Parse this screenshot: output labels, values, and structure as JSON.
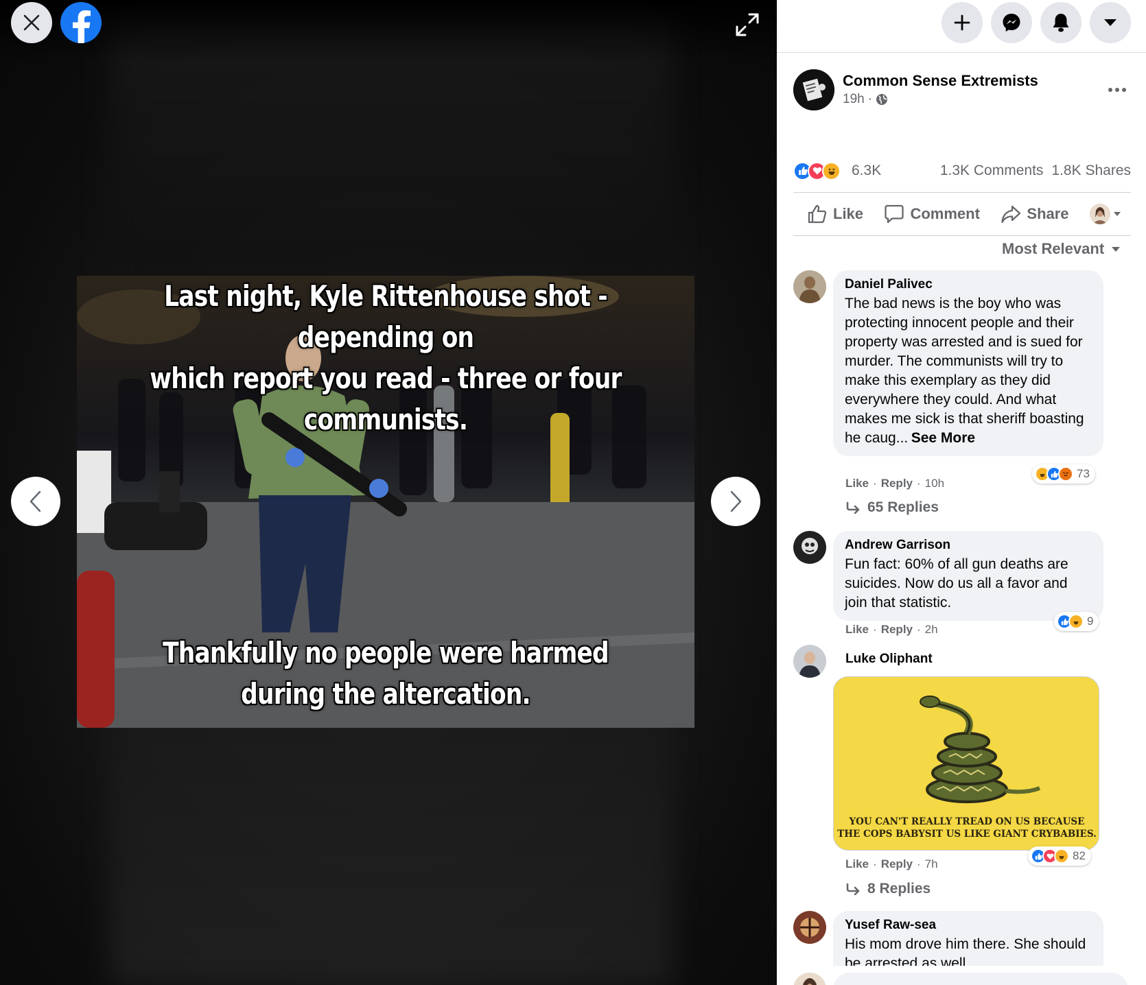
{
  "viewer": {
    "meme_top_line1": "Last night, Kyle Rittenhouse shot -depending on",
    "meme_top_line2": "which report you read - three or four communists.",
    "meme_bottom_line1": "Thankfully no people were harmed",
    "meme_bottom_line2": "during the altercation."
  },
  "post": {
    "page_name": "Common Sense Extremists",
    "time": "19h",
    "reaction_count": "6.3K",
    "comments_count": "1.3K Comments",
    "shares_count": "1.8K Shares",
    "reactions": [
      "like",
      "love",
      "haha"
    ]
  },
  "actions": {
    "like": "Like",
    "comment": "Comment",
    "share": "Share"
  },
  "sort_label": "Most Relevant",
  "comments": [
    {
      "author": "Daniel Palivec",
      "text": "The bad news is the boy who was protecting innocent people and their property was arrested and is sued for murder. The communists will try to make this exemplary as they did everywhere they could. And what makes me sick is that sheriff boasting he caug...",
      "see_more": "See More",
      "reaction_count": "73",
      "reactions": [
        "haha",
        "like",
        "angry"
      ],
      "like": "Like",
      "reply": "Reply",
      "time": "10h",
      "replies": "65 Replies"
    },
    {
      "author": "Andrew Garrison",
      "text": "Fun fact: 60% of all gun deaths are suicides. Now do us all a favor and join that statistic.",
      "reaction_count": "9",
      "reactions": [
        "like",
        "haha"
      ],
      "like": "Like",
      "reply": "Reply",
      "time": "2h"
    },
    {
      "author": "Luke Oliphant",
      "image_caption_line1": "YOU CAN'T REALLY TREAD ON US BECAUSE",
      "image_caption_line2": "THE COPS BABYSIT US LIKE GIANT CRYBABIES.",
      "reaction_count": "82",
      "reactions": [
        "like",
        "love",
        "haha"
      ],
      "like": "Like",
      "reply": "Reply",
      "time": "7h",
      "replies": "8 Replies"
    },
    {
      "author": "Yusef Raw-sea",
      "text": "His mom drove him there. She should be arrested as well"
    }
  ],
  "colors": {
    "facebook_blue": "#1877f2",
    "like": "#1877f2",
    "love": "#f33e58",
    "haha": "#f7b125",
    "angry": "#e9710f",
    "secondary_text": "#65676b"
  }
}
